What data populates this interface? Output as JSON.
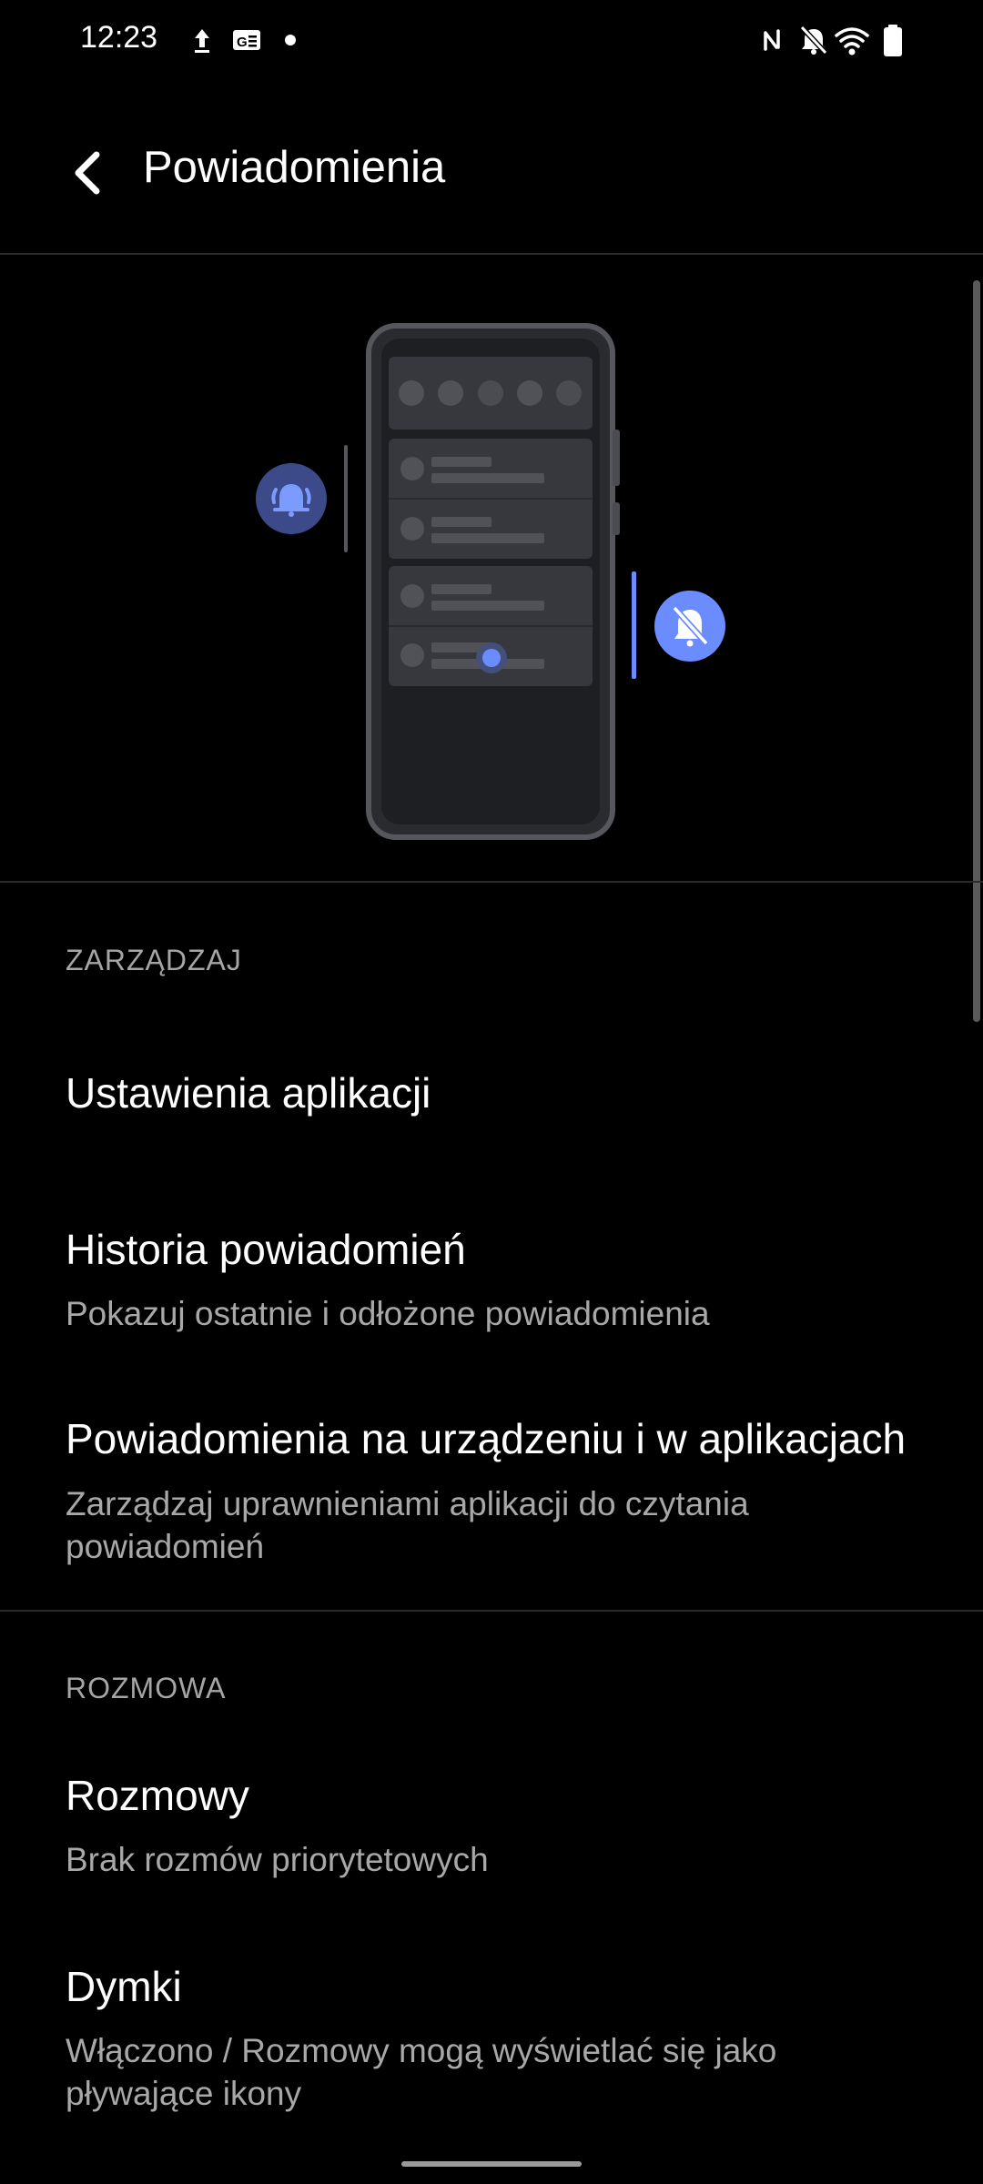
{
  "status_bar": {
    "time": "12:23",
    "left_icons": [
      "upload-icon",
      "translate-app-icon",
      "notification-dot-icon"
    ],
    "right_icons": [
      "nfc-icon",
      "notifications-off-icon",
      "wifi-icon",
      "battery-icon"
    ]
  },
  "app_bar": {
    "back_icon": "arrow-back-icon",
    "title": "Powiadomienia"
  },
  "illustration": {
    "left_icon": "bell-ring-icon",
    "right_icon": "bell-off-icon",
    "accent_color": "#6b8cff"
  },
  "sections": [
    {
      "header": "ZARZĄDZAJ",
      "items": [
        {
          "title": "Ustawienia aplikacji",
          "summary": ""
        },
        {
          "title": "Historia powiadomień",
          "summary": "Pokazuj ostatnie i odłożone powiadomienia"
        },
        {
          "title": "Powiadomienia na urządzeniu i w aplikacjach",
          "summary": "Zarządzaj uprawnieniami aplikacji do czytania powiadomień"
        }
      ]
    },
    {
      "header": "ROZMOWA",
      "items": [
        {
          "title": "Rozmowy",
          "summary": "Brak rozmów priorytetowych"
        },
        {
          "title": "Dymki",
          "summary": "Włączono / Rozmowy mogą wyświetlać się jako pływające ikony"
        }
      ]
    }
  ]
}
